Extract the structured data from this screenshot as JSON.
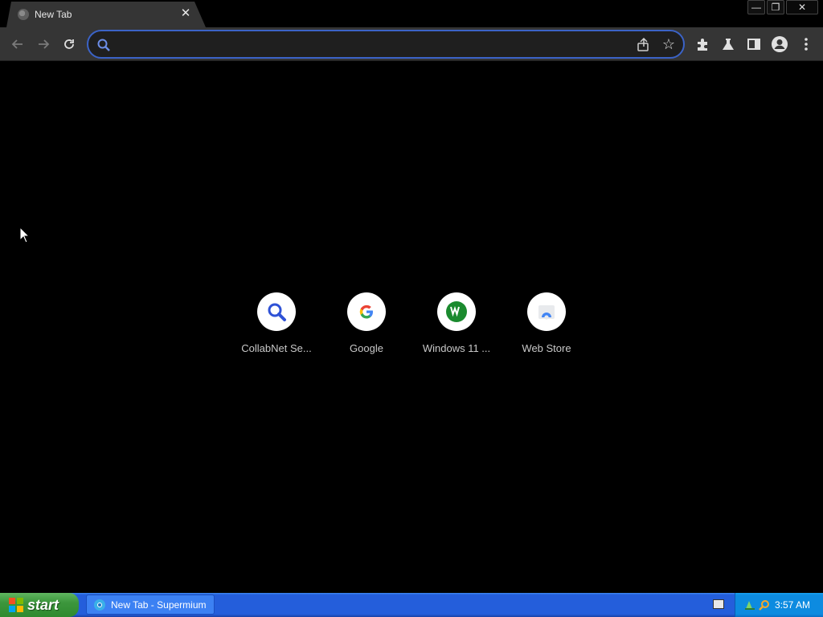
{
  "browser": {
    "tab": {
      "title": "New Tab"
    },
    "window_controls": {
      "minimize": "—",
      "restore": "❐",
      "close": "✕"
    },
    "omnibox": {
      "value": "",
      "placeholder": ""
    }
  },
  "shortcuts": [
    {
      "label": "CollabNet Se...",
      "icon": "collabnet-search-icon"
    },
    {
      "label": "Google",
      "icon": "google-icon"
    },
    {
      "label": "Windows 11 ...",
      "icon": "windows11-w-icon"
    },
    {
      "label": "Web Store",
      "icon": "web-store-icon"
    }
  ],
  "taskbar": {
    "start_label": "start",
    "task_item_label": "New Tab - Supermium",
    "clock": "3:57 AM"
  },
  "colors": {
    "accent": "#3b63c7",
    "tab_bg": "#353535",
    "page_bg": "#000000",
    "xp_blue": "#245edb",
    "xp_green": "#3c963c"
  }
}
